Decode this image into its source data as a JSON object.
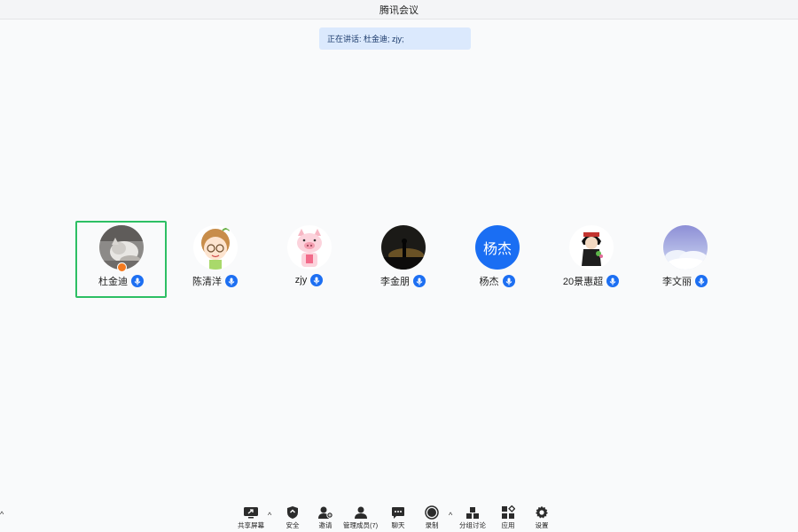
{
  "window": {
    "title": "腾讯会议"
  },
  "speaking": {
    "text": "正在讲话: 杜金迪; zjy;"
  },
  "participants": [
    {
      "name": "杜金迪",
      "avatar": "cat-photo-avatar",
      "host": true,
      "active": true
    },
    {
      "name": "陈清洋",
      "avatar": "cartoon-girl-avatar"
    },
    {
      "name": "zjy",
      "avatar": "pink-pig-avatar"
    },
    {
      "name": "李金朋",
      "avatar": "dark-sunset-avatar"
    },
    {
      "name": "杨杰",
      "avatar": "initials-avatar",
      "initials": "杨杰",
      "color": "#1a6ef3"
    },
    {
      "name": "20景惠超",
      "avatar": "anime-figure-avatar"
    },
    {
      "name": "李文丽",
      "avatar": "sky-clouds-avatar"
    }
  ],
  "toolbar": {
    "share": "共享屏幕",
    "security": "安全",
    "invite": "邀请",
    "manage": "管理成员(7)",
    "chat": "聊天",
    "record": "录制",
    "breakout": "分组讨论",
    "apps": "应用",
    "settings": "设置"
  },
  "colors": {
    "accent": "#1d6ff2",
    "active_border": "#2dbf64",
    "host_badge": "#f47a1f"
  }
}
